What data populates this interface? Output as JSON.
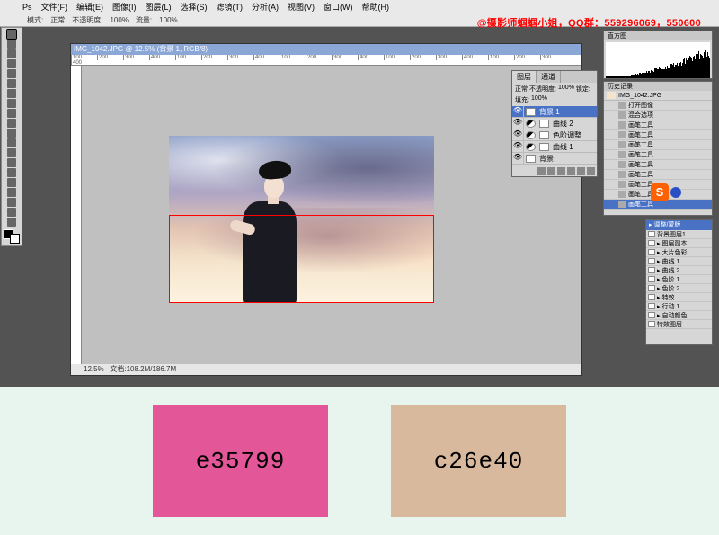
{
  "menu": {
    "ps": "Ps",
    "file": "文件(F)",
    "edit": "编辑(E)",
    "image": "图像(I)",
    "layer": "图层(L)",
    "select": "选择(S)",
    "filter": "滤镜(T)",
    "analysis": "分析(A)",
    "view": "视图(V)",
    "window": "窗口(W)",
    "help": "帮助(H)"
  },
  "options": {
    "mode_label": "模式:",
    "mode_value": "正常",
    "opacity_label": "不透明度:",
    "opacity_value": "100%",
    "flow_label": "流量:",
    "flow_value": "100%"
  },
  "watermark": "@摄影师蝈蝈小姐，QQ群：559296069，550600",
  "doc": {
    "title": "IMG_1042.JPG @ 12.5% (背景 1, RGB/8)",
    "zoom": "12.5%",
    "status": "文档:108.2M/186.7M"
  },
  "ruler_ticks": [
    "100",
    "200",
    "300",
    "400",
    "100",
    "200",
    "300",
    "400",
    "100",
    "200",
    "300",
    "400",
    "100",
    "200",
    "300",
    "400",
    "100",
    "200",
    "300",
    "400"
  ],
  "layers_panel": {
    "tab1": "图层",
    "tab2": "通道",
    "blend": "正常",
    "opacity_label": "不透明度:",
    "opacity": "100%",
    "lock_label": "锁定:",
    "fill_label": "填充:",
    "fill": "100%",
    "items": [
      {
        "name": "背景 1",
        "type": "raster",
        "selected": true
      },
      {
        "name": "曲线 2",
        "type": "adj",
        "selected": false
      },
      {
        "name": "色阶调整",
        "type": "adj",
        "selected": false
      },
      {
        "name": "曲线 1",
        "type": "adj",
        "selected": false
      },
      {
        "name": "背景",
        "type": "raster",
        "selected": false
      }
    ]
  },
  "nav": {
    "tab": "直方图"
  },
  "history": {
    "tab": "历史记录",
    "file": "IMG_1042.JPG",
    "items": [
      "打开图像",
      "混合选项",
      "画笔工具",
      "画笔工具",
      "画笔工具",
      "画笔工具",
      "画笔工具",
      "画笔工具",
      "画笔工具",
      "画笔工具",
      "画笔工具"
    ]
  },
  "layers2": {
    "header": "▸ 调整/蒙版",
    "items": [
      "背景图层1",
      "▸ 图层副本",
      "▸ 大片色彩",
      "▸ 曲线 1",
      "▸ 曲线 2",
      "▸ 色阶 1",
      "▸ 色阶 2",
      "▸ 特效",
      "▸ 行动 1",
      "▸ 自动颜色",
      "特效图层"
    ]
  },
  "badge": "S",
  "swatches": {
    "color1_hex": "e35799",
    "color1_css": "#e35799",
    "color2_hex": "c26e40",
    "color2_css": "#d9b99e"
  }
}
